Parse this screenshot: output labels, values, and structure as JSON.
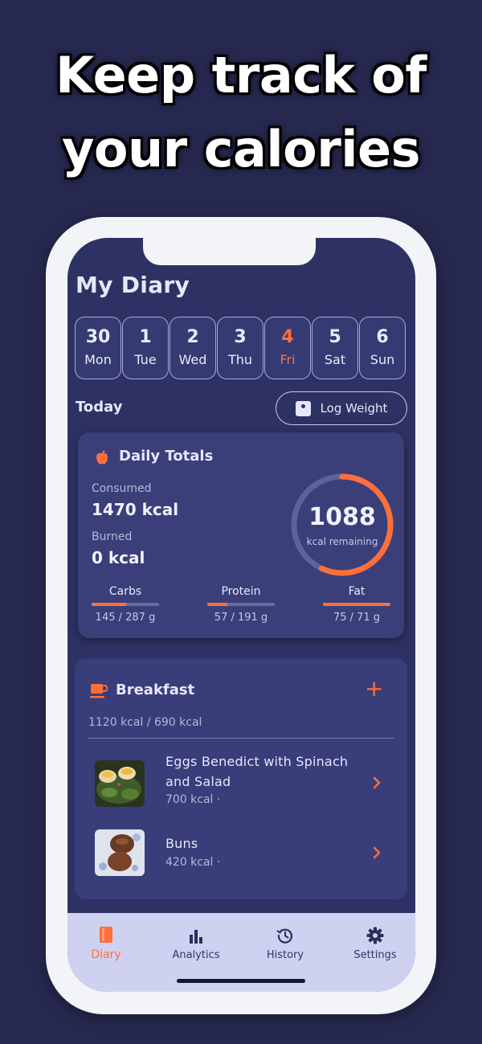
{
  "headline": {
    "line1": "Keep track of",
    "line2": "your calories"
  },
  "colors": {
    "accent": "#ff6f3a",
    "background": "#26284f",
    "screen": "#2e3163",
    "card": "#3a3f7a",
    "navbar": "#cfd1f1"
  },
  "diary": {
    "title": "My Diary",
    "days": [
      {
        "num": "30",
        "name": "Mon"
      },
      {
        "num": "1",
        "name": "Tue"
      },
      {
        "num": "2",
        "name": "Wed"
      },
      {
        "num": "3",
        "name": "Thu"
      },
      {
        "num": "4",
        "name": "Fri",
        "selected": true
      },
      {
        "num": "5",
        "name": "Sat"
      },
      {
        "num": "6",
        "name": "Sun"
      }
    ],
    "today_label": "Today",
    "log_weight_label": "Log Weight"
  },
  "daily_totals": {
    "title": "Daily Totals",
    "consumed_label": "Consumed",
    "consumed_value": "1470 kcal",
    "burned_label": "Burned",
    "burned_value": "0 kcal",
    "remaining_value": "1088",
    "remaining_label": "kcal remaining",
    "ring_progress": 0.57,
    "macros": [
      {
        "name": "Carbs",
        "value": "145 / 287 g",
        "progress": 0.51
      },
      {
        "name": "Protein",
        "value": "57 / 191 g",
        "progress": 0.3
      },
      {
        "name": "Fat",
        "value": "75 / 71 g",
        "progress": 1.0
      }
    ]
  },
  "breakfast": {
    "title": "Breakfast",
    "add_label": "+",
    "summary": "1120 kcal / 690 kcal",
    "items": [
      {
        "name": "Eggs Benedict with Spinach and Salad",
        "kcal": "700 kcal ·"
      },
      {
        "name": "Buns",
        "kcal": "420 kcal ·"
      }
    ]
  },
  "nav": {
    "items": [
      {
        "label": "Diary",
        "icon": "book-icon",
        "active": true
      },
      {
        "label": "Analytics",
        "icon": "bar-chart-icon"
      },
      {
        "label": "History",
        "icon": "history-icon"
      },
      {
        "label": "Settings",
        "icon": "gear-icon"
      }
    ]
  }
}
